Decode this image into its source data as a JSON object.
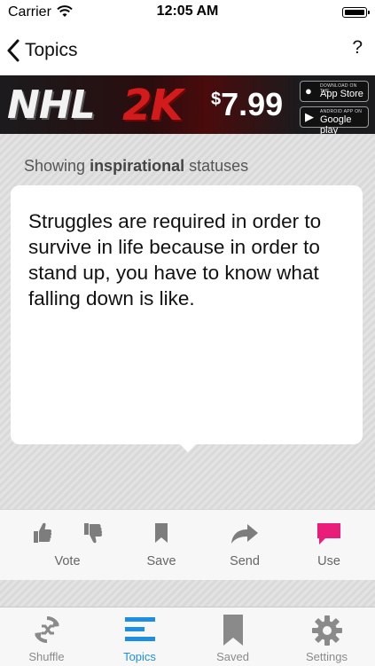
{
  "status_bar": {
    "carrier": "Carrier",
    "time": "12:05 AM"
  },
  "nav": {
    "back_label": "Topics",
    "help_label": "?"
  },
  "ad": {
    "logo_nhl": "NHL",
    "logo_2k": "2K",
    "price_symbol": "$",
    "price_value": "7.99",
    "app_store_small": "Download on the",
    "app_store_big": "App Store",
    "google_play_small": "ANDROID APP ON",
    "google_play_big": "Google play"
  },
  "content": {
    "showing_prefix": "Showing",
    "showing_topic": "inspirational",
    "showing_suffix": "statuses",
    "quote": "Struggles are required in order to survive in life because in order to stand up, you have to know what falling down is like."
  },
  "actions": {
    "vote": "Vote",
    "save": "Save",
    "send": "Send",
    "use": "Use"
  },
  "tabs": [
    {
      "label": "Shuffle",
      "icon": "shuffle-icon"
    },
    {
      "label": "Topics",
      "icon": "topics-icon"
    },
    {
      "label": "Saved",
      "icon": "bookmark-icon"
    },
    {
      "label": "Settings",
      "icon": "gear-icon"
    }
  ],
  "colors": {
    "accent": "#1d8fe3",
    "use_pink": "#e91e7a",
    "icon_gray": "#7d7d7d",
    "ad_red": "#d31b1b"
  }
}
